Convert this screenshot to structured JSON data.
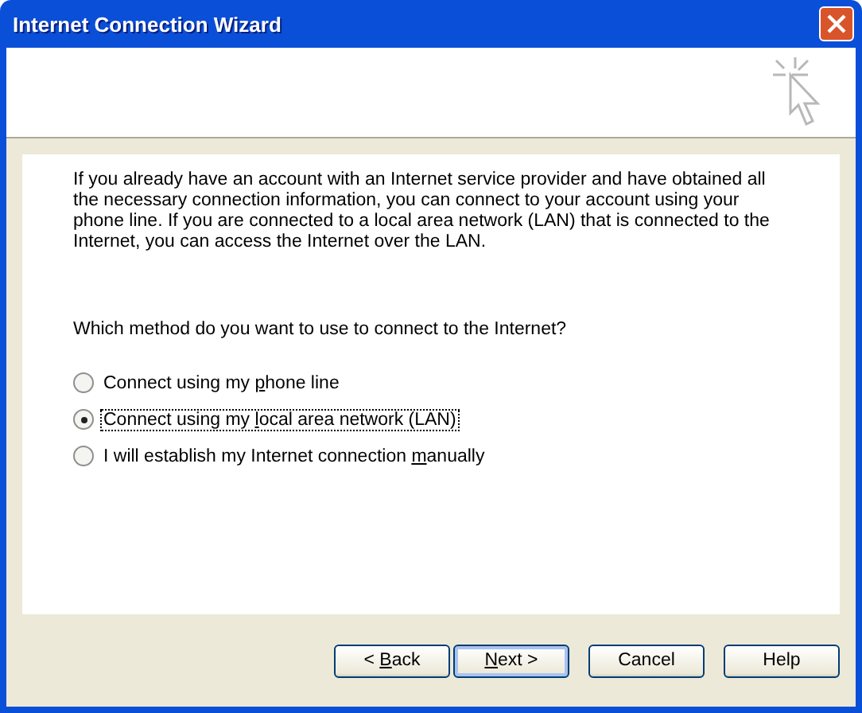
{
  "window": {
    "title": "Internet Connection Wizard"
  },
  "intro": "If you already have an account with an Internet service provider and have obtained all the necessary connection information, you can connect to your account using your phone line. If you are connected to a local area network (LAN) that is connected to the Internet, you can access the Internet over the LAN.",
  "question": "Which method do you want to use to connect to the Internet?",
  "options": [
    {
      "label_before": "Connect using my ",
      "access_key": "p",
      "label_after": "hone line",
      "selected": false,
      "focused": false
    },
    {
      "label_before": "Connect using my ",
      "access_key": "l",
      "label_after": "ocal area network (LAN)",
      "selected": true,
      "focused": true
    },
    {
      "label_before": "I will establish my Internet connection ",
      "access_key": "m",
      "label_after": "anually",
      "selected": false,
      "focused": false
    }
  ],
  "buttons": [
    {
      "label_before": "< ",
      "access_key": "B",
      "label_after": "ack",
      "default": false
    },
    {
      "access_key": "N",
      "label_after": "ext >",
      "default": true
    },
    {
      "label_before": "Cancel",
      "default": false
    },
    {
      "label_before": "Help",
      "default": false
    }
  ]
}
